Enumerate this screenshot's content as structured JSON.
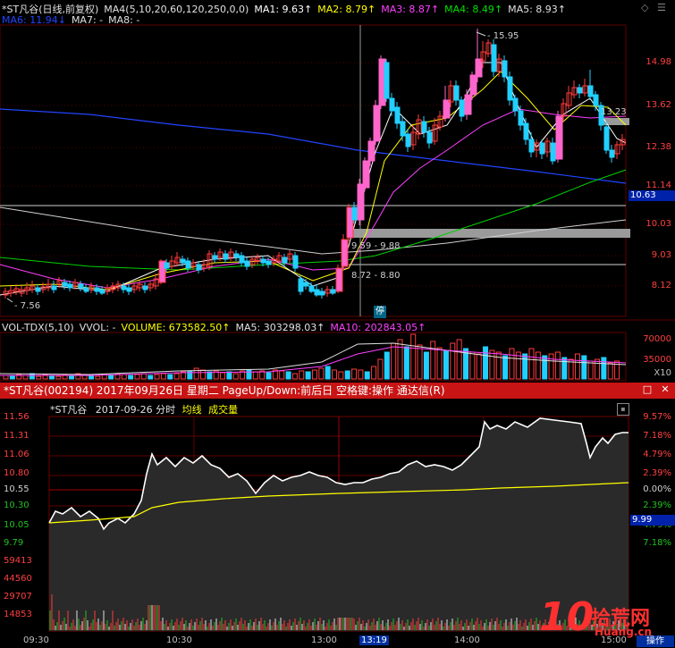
{
  "upper_header": {
    "row1": [
      {
        "text": "*ST凡谷(日线,前复权)",
        "color": "#e0e0e0"
      },
      {
        "text": "MA4(5,10,20,60,120,250,0,0)",
        "color": "#e0e0e0"
      },
      {
        "text": "MA1: 9.63↑",
        "color": "#ffffff"
      },
      {
        "text": "MA2: 8.79↑",
        "color": "#ffff00"
      },
      {
        "text": "MA3: 8.87↑",
        "color": "#ff40ff"
      },
      {
        "text": "MA4: 8.49↑",
        "color": "#00e000"
      },
      {
        "text": "MA5: 8.93↑",
        "color": "#e0e0e0"
      }
    ],
    "row2": [
      {
        "text": "MA6: 11.94↓",
        "color": "#2244ff"
      },
      {
        "text": "MA7: -",
        "color": "#e0e0e0"
      },
      {
        "text": "MA8: -",
        "color": "#e0e0e0"
      }
    ]
  },
  "price_axis": [
    "14.98",
    "13.62",
    "12.38",
    "11.14",
    "10.03",
    "9.03",
    "8.12"
  ],
  "current_price_tag": "10.63",
  "annotations": {
    "high": "15.95",
    "low": "7.56",
    "gap1": "9.59 - 9.88",
    "gap2": "8.72 - 8.80",
    "right_gap": "13.23",
    "stop_label": "停"
  },
  "volume_header": [
    {
      "text": "VOL-TDX(5,10)",
      "color": "#e0e0e0"
    },
    {
      "text": "VVOL: -",
      "color": "#e0e0e0"
    },
    {
      "text": "VOLUME: 673582.50↑",
      "color": "#ffff00"
    },
    {
      "text": "MA5: 303298.03↑",
      "color": "#e0e0e0"
    },
    {
      "text": "MA10: 202843.05↑",
      "color": "#ff40ff"
    }
  ],
  "volume_axis": [
    "70000",
    "35000"
  ],
  "volume_unit": "X10",
  "lower_title": "*ST凡谷(002194) 2017年09月26日 星期二 PageUp/Down:前后日 空格键:操作 通达信(R)",
  "window_buttons": {
    "restore": "□",
    "close": "✕"
  },
  "intraday_header": {
    "name": "*ST凡谷",
    "date": "2017-09-26 分时",
    "avg": "均线",
    "vol": "成交量"
  },
  "intraday_price_axis": [
    "11.56",
    "11.31",
    "11.06",
    "10.80",
    "10.55",
    "10.30",
    "10.05",
    "9.79"
  ],
  "intraday_pct_axis": [
    "9.57%",
    "7.18%",
    "4.79%",
    "2.39%",
    "0.00%",
    "2.39%",
    "4.79%",
    "7.18%"
  ],
  "intraday_price_tag": "9.99",
  "intraday_vol_axis": [
    "59413",
    "44560",
    "29707",
    "14853"
  ],
  "time_axis": [
    "09:30",
    "10:30",
    "13:00",
    "13:19",
    "14:00",
    "15:00"
  ],
  "watermark": {
    "big": "10",
    "text": "拾荒网",
    "sub": "Huang.cn"
  },
  "bottom_btn": "操作",
  "colors": {
    "up": "#ff3b3b",
    "down": "#21d0ff",
    "up_fill": "#ff66cc",
    "ma_white": "#ffffff",
    "ma_yellow": "#ffff00",
    "ma_purple": "#ff40ff",
    "ma_green": "#00d000",
    "ma_blue": "#2244ff"
  }
}
